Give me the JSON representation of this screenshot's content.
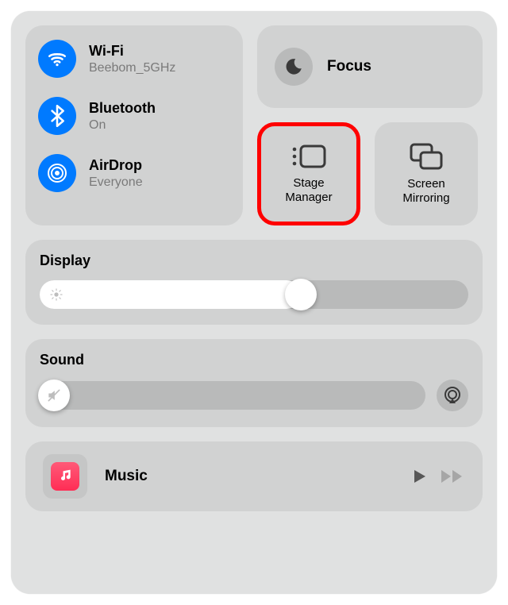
{
  "colors": {
    "accent": "#007aff",
    "highlight": "#ff0000"
  },
  "connectivity": {
    "wifi": {
      "label": "Wi-Fi",
      "status": "Beebom_5GHz",
      "on": true
    },
    "bluetooth": {
      "label": "Bluetooth",
      "status": "On",
      "on": true
    },
    "airdrop": {
      "label": "AirDrop",
      "status": "Everyone",
      "on": true
    }
  },
  "focus": {
    "label": "Focus",
    "on": false
  },
  "stage_manager": {
    "label1": "Stage",
    "label2": "Manager",
    "highlighted": true
  },
  "screen_mirror": {
    "label1": "Screen",
    "label2": "Mirroring"
  },
  "display": {
    "label": "Display",
    "value_percent": 61
  },
  "sound": {
    "label": "Sound",
    "value_percent": 0
  },
  "media": {
    "app": "Music",
    "title": "Music"
  }
}
